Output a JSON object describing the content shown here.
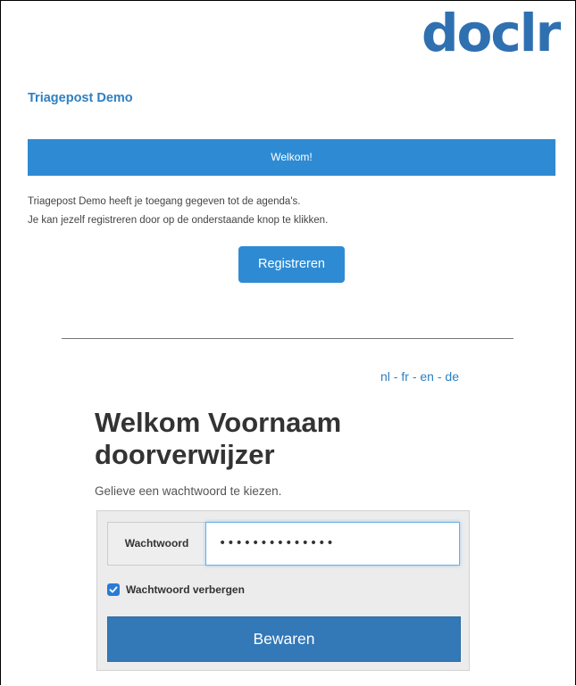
{
  "brand": {
    "logo_text": "doclr",
    "logo_color": "#2f70b1"
  },
  "org": {
    "title": "Triagepost Demo"
  },
  "welcome_bar": {
    "text": "Welkom!",
    "color": "#2e8bd3"
  },
  "intro": {
    "line1": "Triagepost Demo heeft je toegang gegeven tot de agenda's.",
    "line2": "Je kan jezelf registreren door op de onderstaande knop te klikken."
  },
  "register_button": {
    "label": "Registreren"
  },
  "language": {
    "options": [
      "nl",
      "fr",
      "en",
      "de"
    ],
    "separator": "-"
  },
  "form": {
    "heading": "Welkom Voornaam doorverwijzer",
    "subtext": "Gelieve een wachtwoord te kiezen.",
    "password_label": "Wachtwoord",
    "password_value": "••••••••••••••",
    "hide_password_label": "Wachtwoord verbergen",
    "hide_password_checked": true,
    "save_label": "Bewaren",
    "save_color": "#3378b7"
  }
}
